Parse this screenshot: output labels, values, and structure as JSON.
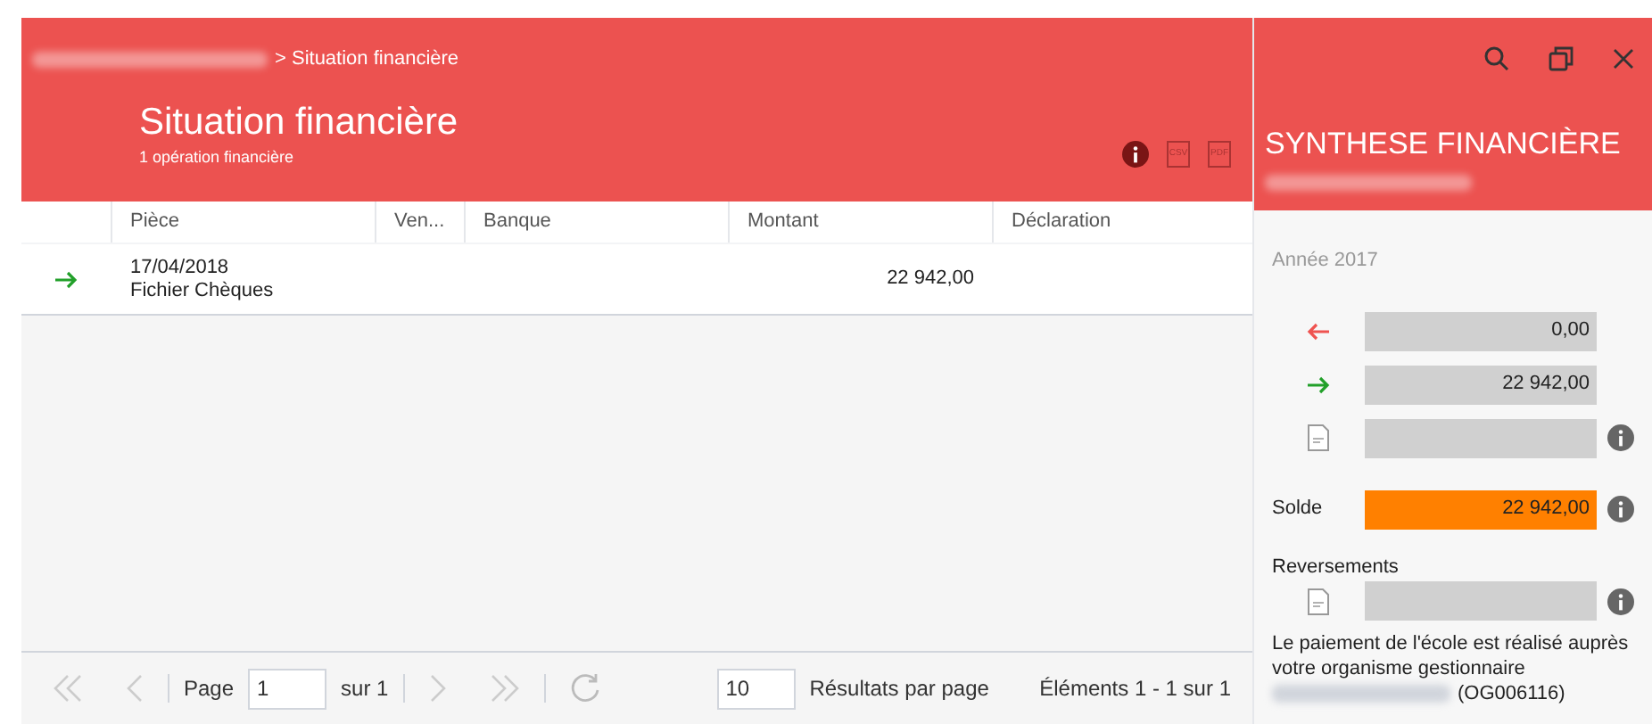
{
  "breadcrumb": {
    "current": "> Situation financière"
  },
  "header": {
    "title": "Situation financière",
    "subtitle": "1 opération financière"
  },
  "toolbar": {
    "export_csv": "CSV",
    "export_pdf": "PDF"
  },
  "table": {
    "columns": [
      "Pièce",
      "Ven...",
      "Banque",
      "Montant",
      "Déclaration"
    ],
    "rows": [
      {
        "kind": "in",
        "date": "17/04/2018",
        "label": "Fichier Chèques",
        "montant": "22 942,00"
      }
    ]
  },
  "pager": {
    "first_disabled": true,
    "prev_disabled": true,
    "next_disabled": true,
    "last_disabled": true,
    "page_label": "Page",
    "page": "1",
    "of": "sur 1",
    "page_size": "10",
    "page_size_label": "Résultats par page",
    "summary": "Éléments 1 - 1 sur 1"
  },
  "synthese": {
    "title": "SYNTHESE FINANCIÈRE",
    "year": "Année 2017",
    "lines": [
      {
        "kind": "out",
        "value": "0,00",
        "info": false
      },
      {
        "kind": "in",
        "value": "22 942,00",
        "info": false
      },
      {
        "kind": "ta",
        "info": true
      }
    ],
    "solde_label": "Solde",
    "solde": "22 942,00",
    "reversements_label": "Reversements",
    "reversement": {
      "kind": "ta",
      "info": true
    },
    "note_start": "Le paiement de l'école est réalisé auprès votre organisme gestionnaire",
    "note_end": "(OG006116)"
  }
}
